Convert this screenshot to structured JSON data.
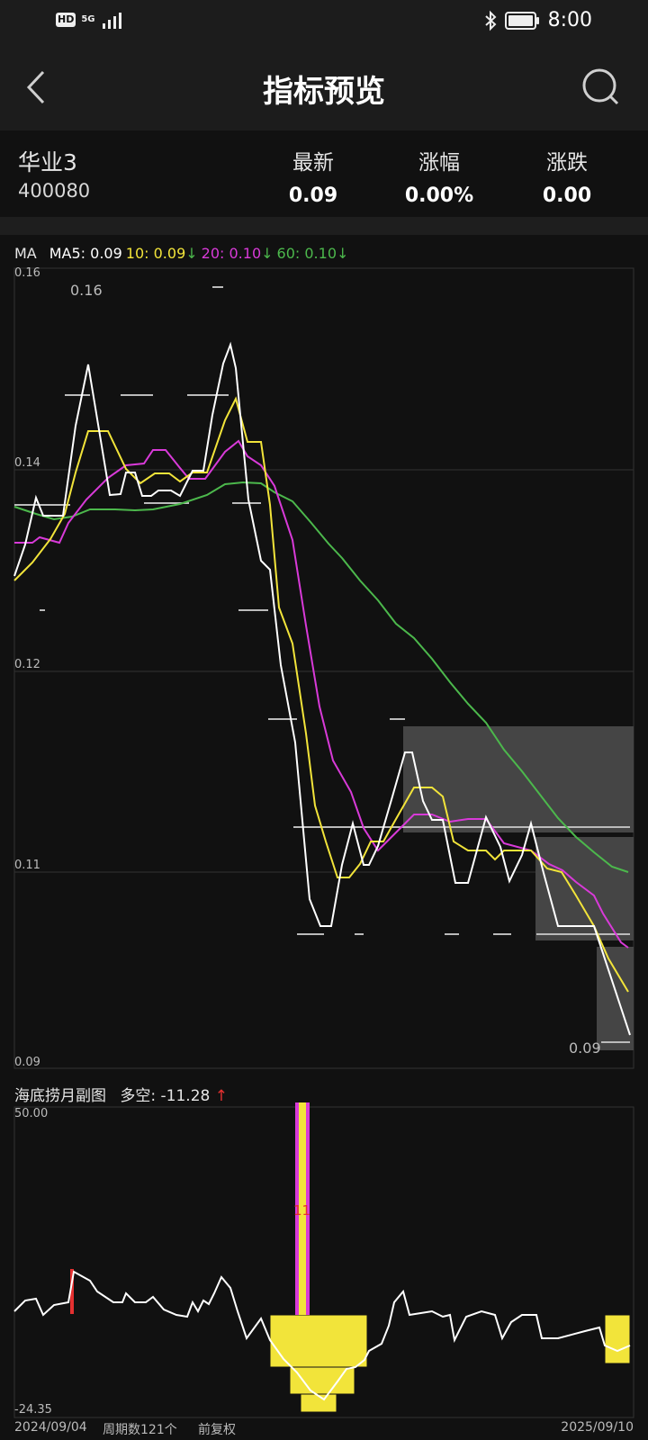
{
  "status_bar": {
    "hd": "HD",
    "network": "5G",
    "time": "8:00"
  },
  "header": {
    "title": "指标预览"
  },
  "stock": {
    "name": "华业3",
    "code": "400080",
    "columns": [
      {
        "label": "最新",
        "value": "0.09"
      },
      {
        "label": "涨幅",
        "value": "0.00%"
      },
      {
        "label": "涨跌",
        "value": "0.00"
      }
    ]
  },
  "ma_legend": {
    "title": "MA",
    "ma5": "MA5: 0.09",
    "ma10": "10: 0.09",
    "ma20": "20: 0.10",
    "ma60": "60: 0.10",
    "down_arrow": "↓",
    "colors": {
      "ma5": "#ffffff",
      "ma10": "#f2e43a",
      "ma20": "#d83ad8",
      "ma60": "#4cb84c"
    }
  },
  "main_chart": {
    "y_labels": [
      "0.16",
      "0.14",
      "0.12",
      "0.11",
      "0.09"
    ],
    "high_label": "0.16",
    "low_label": "0.09"
  },
  "sub_chart": {
    "name": "海底捞月副图",
    "indicator": "多空: -11.28",
    "up_arrow": "↑",
    "y_top": "50.00",
    "y_bottom": "-24.35",
    "marker": "11"
  },
  "footer": {
    "start_date": "2024/09/04",
    "period_count": "周期数121个",
    "adjust": "前复权",
    "end_date": "2025/09/10"
  },
  "chart_data": {
    "type": "line",
    "series": [
      {
        "name": "MA5",
        "color": "#ffffff",
        "values": [
          0.132,
          0.135,
          0.138,
          0.137,
          0.14,
          0.147,
          0.151,
          0.146,
          0.138,
          0.138,
          0.14,
          0.139,
          0.139,
          0.139,
          0.139,
          0.142,
          0.147,
          0.153,
          0.15,
          0.138,
          0.133,
          0.126,
          0.119,
          0.11,
          0.108,
          0.112,
          0.114,
          0.112,
          0.113,
          0.118,
          0.117,
          0.114,
          0.114,
          0.112,
          0.114,
          0.113,
          0.111,
          0.112,
          0.109,
          0.109,
          0.109,
          0.1,
          0.097
        ]
      },
      {
        "name": "MA10",
        "color": "#f2e43a",
        "values": [
          0.13,
          0.133,
          0.136,
          0.137,
          0.141,
          0.144,
          0.144,
          0.141,
          0.139,
          0.14,
          0.14,
          0.14,
          0.14,
          0.14,
          0.14,
          0.141,
          0.144,
          0.147,
          0.145,
          0.137,
          0.128,
          0.118,
          0.112,
          0.109,
          0.11,
          0.112,
          0.115,
          0.115,
          0.113,
          0.113,
          0.114,
          0.114,
          0.113,
          0.113,
          0.112,
          0.111,
          0.11,
          0.109,
          0.108,
          0.107,
          0.106,
          0.104,
          0.101
        ]
      },
      {
        "name": "MA20",
        "color": "#d83ad8",
        "values": [
          0.133,
          0.133,
          0.134,
          0.137,
          0.139,
          0.14,
          0.141,
          0.141,
          0.142,
          0.141,
          0.14,
          0.14,
          0.141,
          0.142,
          0.143,
          0.143,
          0.141,
          0.139,
          0.133,
          0.125,
          0.117,
          0.113,
          0.111,
          0.112,
          0.113,
          0.114,
          0.114,
          0.113,
          0.113,
          0.112,
          0.112,
          0.111,
          0.11,
          0.109,
          0.108,
          0.107,
          0.106
        ]
      },
      {
        "name": "MA60",
        "color": "#4cb84c",
        "values": [
          0.137,
          0.136,
          0.136,
          0.137,
          0.137,
          0.137,
          0.137,
          0.138,
          0.139,
          0.139,
          0.139,
          0.138,
          0.136,
          0.133,
          0.131,
          0.129,
          0.127,
          0.125,
          0.123,
          0.121,
          0.119,
          0.117,
          0.115,
          0.113,
          0.112,
          0.111,
          0.11,
          0.109
        ]
      }
    ],
    "ylim": [
      0.09,
      0.16
    ]
  }
}
